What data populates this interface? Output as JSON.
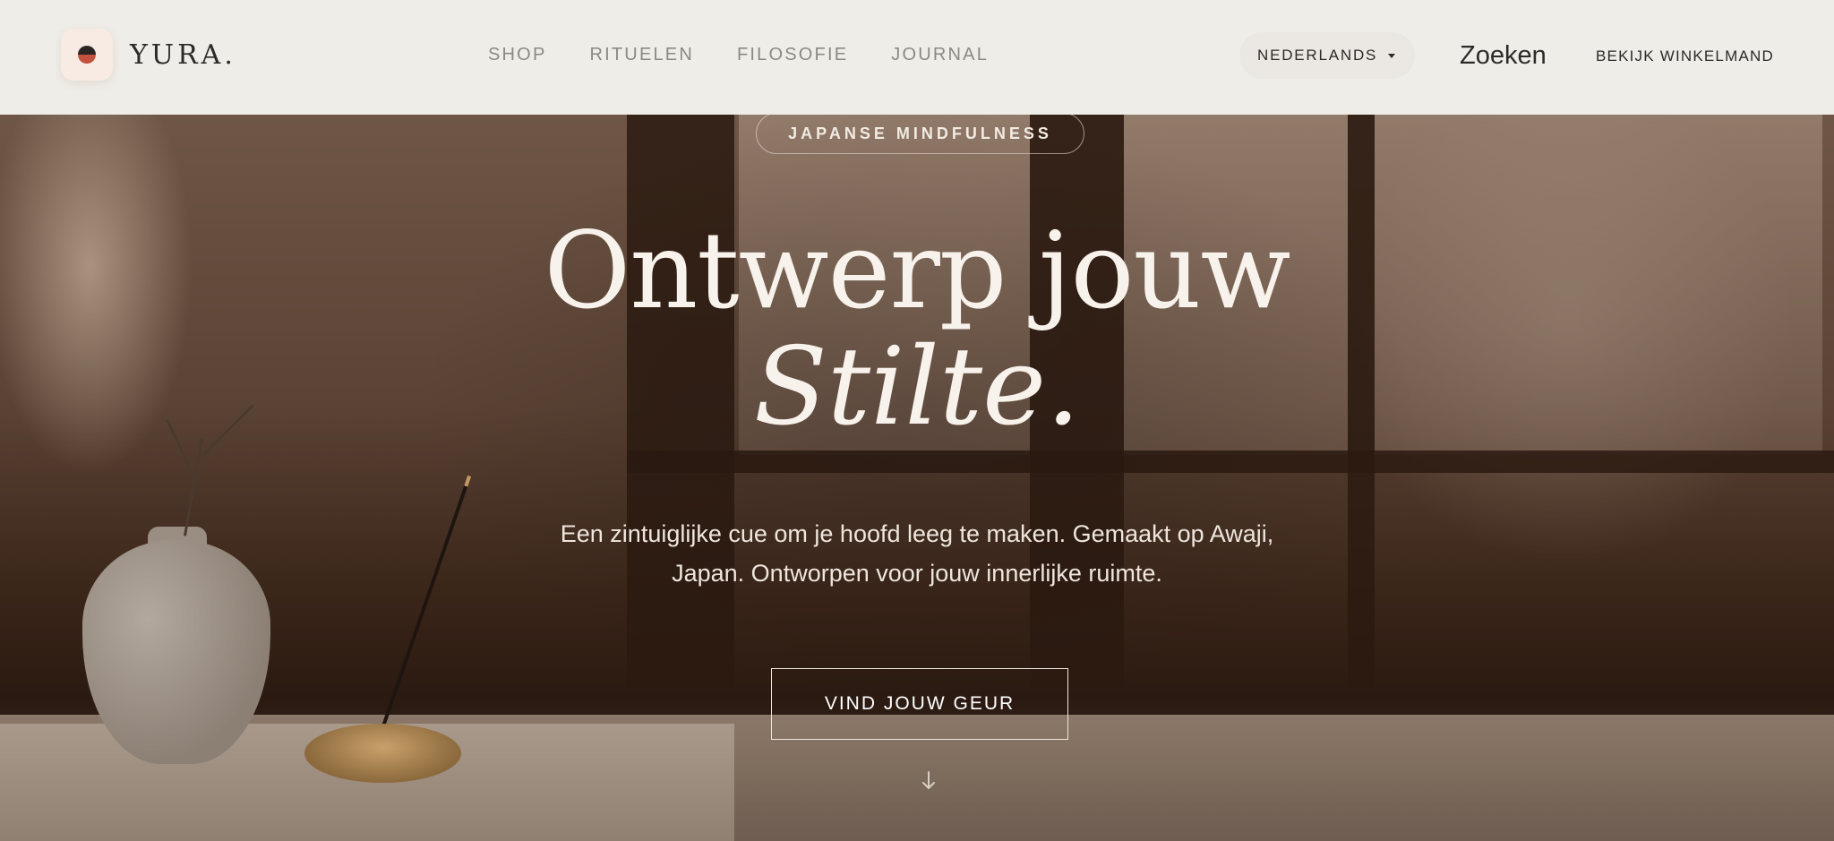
{
  "header": {
    "logo_text": "YURA.",
    "nav": [
      "SHOP",
      "RITUELEN",
      "FILOSOFIE",
      "JOURNAL"
    ],
    "language": "NEDERLANDS",
    "search_label": "Zoeken",
    "cart_label": "BEKIJK WINKELMAND"
  },
  "hero": {
    "tagline": "JAPANSE MINDFULNESS",
    "headline_line1": "Ontwerp jouw",
    "headline_line2": "Stilte.",
    "subtitle": "Een zintuiglijke cue om je hoofd leeg te maken. Gemaakt op Awaji, Japan. Ontworpen voor jouw innerlijke ruimte.",
    "cta_label": "VIND JOUW GEUR"
  },
  "icons": {
    "logo": "yura-logo-icon",
    "language_caret": "caret-down-icon",
    "scroll": "arrow-down-icon"
  },
  "colors": {
    "header_bg": "#efede8",
    "accent_red": "#c2523d",
    "text_dark": "#2d2a27",
    "nav_gray": "#8c8985"
  }
}
